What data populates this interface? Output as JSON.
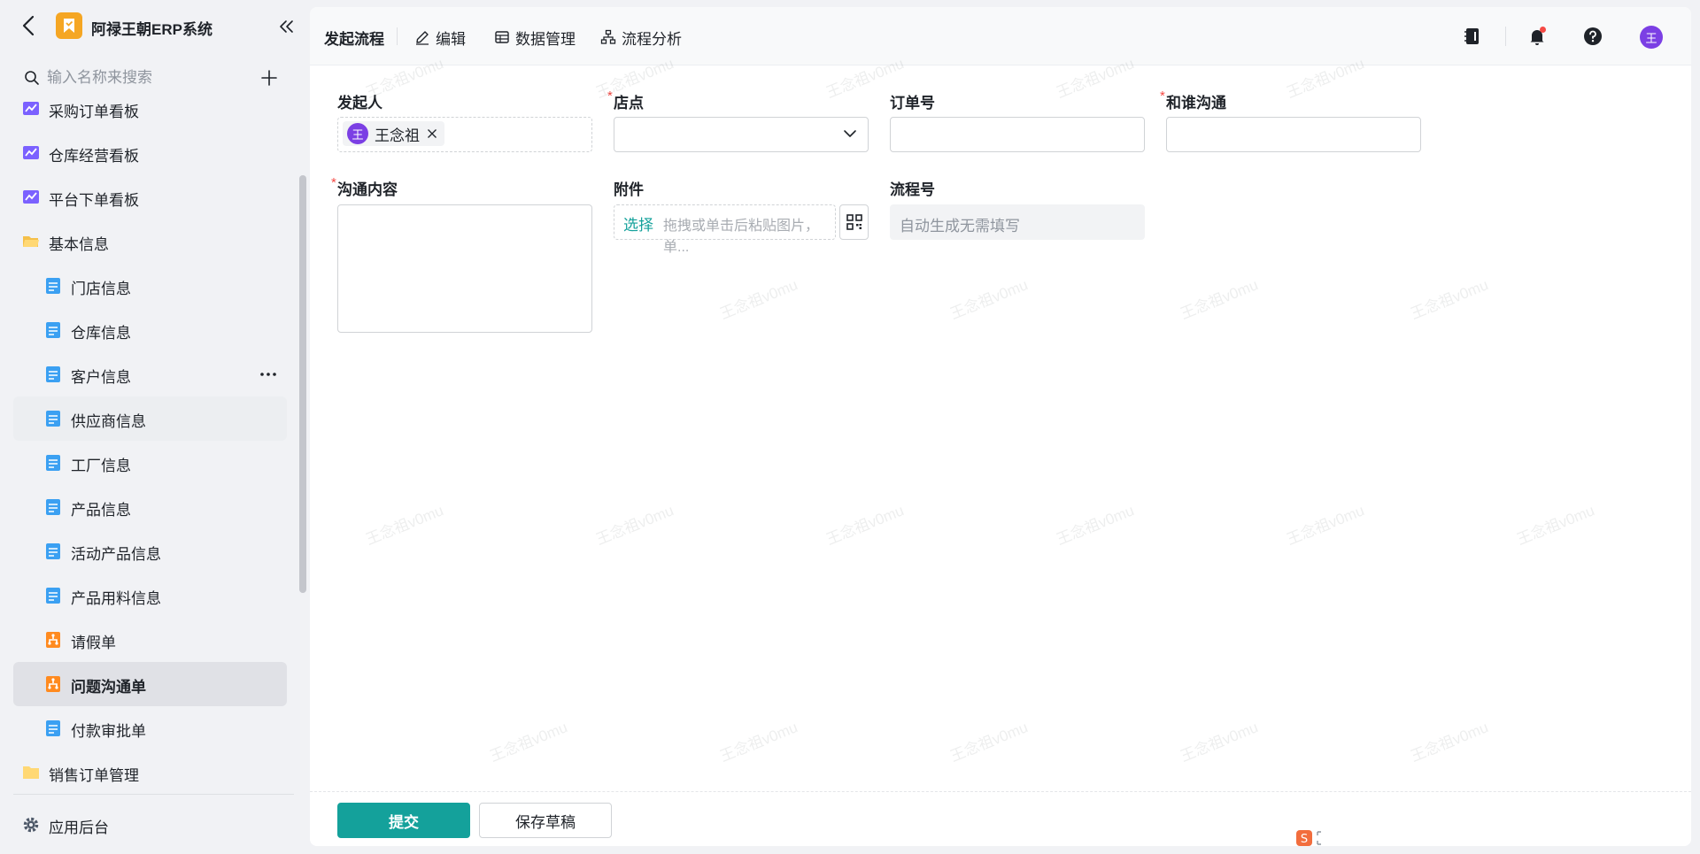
{
  "app": {
    "title": "阿禄王朝ERP系统"
  },
  "sidebar": {
    "search_placeholder": "输入名称来搜索",
    "items": [
      {
        "label": "采购订单看板",
        "icon": "chart-board-icon",
        "level": 1
      },
      {
        "label": "仓库经营看板",
        "icon": "chart-board-icon",
        "level": 1
      },
      {
        "label": "平台下单看板",
        "icon": "chart-board-icon",
        "level": 1
      },
      {
        "label": "基本信息",
        "icon": "folder-open-icon",
        "level": 1
      },
      {
        "label": "门店信息",
        "icon": "form-icon",
        "level": 2
      },
      {
        "label": "仓库信息",
        "icon": "form-icon",
        "level": 2
      },
      {
        "label": "客户信息",
        "icon": "form-icon",
        "level": 2
      },
      {
        "label": "供应商信息",
        "icon": "form-icon",
        "level": 2
      },
      {
        "label": "工厂信息",
        "icon": "form-icon",
        "level": 2
      },
      {
        "label": "产品信息",
        "icon": "form-icon",
        "level": 2
      },
      {
        "label": "活动产品信息",
        "icon": "form-icon",
        "level": 2
      },
      {
        "label": "产品用料信息",
        "icon": "form-icon",
        "level": 2
      },
      {
        "label": "请假单",
        "icon": "workflow-icon",
        "level": 2
      },
      {
        "label": "问题沟通单",
        "icon": "workflow-icon",
        "level": 2,
        "active": true
      },
      {
        "label": "付款审批单",
        "icon": "form-icon",
        "level": 2
      },
      {
        "label": "销售订单管理",
        "icon": "folder-icon",
        "level": 1
      }
    ],
    "settings_label": "应用后台"
  },
  "topbar": {
    "start_flow": "发起流程",
    "edit": "编辑",
    "data_manage": "数据管理",
    "flow_analysis": "流程分析",
    "user_avatar": "王"
  },
  "form": {
    "initiator": {
      "label": "发起人",
      "user_name": "王念祖",
      "user_avatar": "王"
    },
    "store": {
      "label": "店点",
      "required": "*",
      "value": ""
    },
    "order_no": {
      "label": "订单号",
      "value": ""
    },
    "contact_with": {
      "label": "和谁沟通",
      "required": "*",
      "value": ""
    },
    "content": {
      "label": "沟通内容",
      "required": "*",
      "value": ""
    },
    "attachment": {
      "label": "附件",
      "choose": "选择",
      "hint": "拖拽或单击后粘贴图片，单..."
    },
    "flow_no": {
      "label": "流程号",
      "placeholder": "自动生成无需填写"
    }
  },
  "footer": {
    "submit": "提交",
    "save_draft": "保存草稿"
  },
  "watermark": "王念祖v0mu",
  "colors": {
    "accent": "#14a19b",
    "avatar": "#7b3fe4",
    "required": "#f54a45",
    "logo": "#f5a623"
  }
}
